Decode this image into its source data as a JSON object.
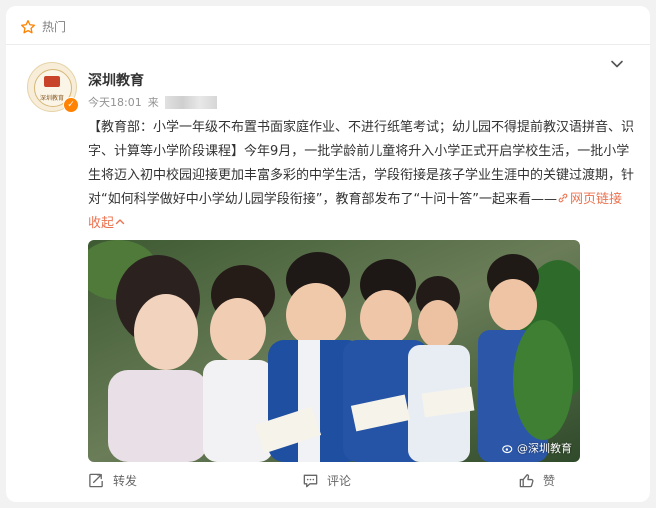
{
  "header": {
    "hot_label": "热门"
  },
  "post": {
    "author": "深圳教育",
    "time": "今天18:01",
    "source_prefix": "来",
    "avatar_text": "深圳教育",
    "text_main": "【教育部：小学一年级不布置书面家庭作业、不进行纸笔考试；幼儿园不得提前教汉语拼音、识字、计算等小学阶段课程】今年9月，一批学龄前儿童将升入小学正式开启学校生活，一批小学生将迈入初中校园迎接更加丰富多彩的中学生活，学段衔接是孩子学业生涯中的关键过渡期，针对“如何科学做好中小学幼儿园学段衔接”，教育部发布了“十问十答”一起来看——",
    "link_text": "网页链接",
    "collapse_text": "收起",
    "image_watermark": "@深圳教育"
  },
  "actions": {
    "repost": "转发",
    "comment": "评论",
    "like": "赞"
  },
  "colors": {
    "accent": "#eb7350",
    "verified": "#ff8200",
    "hot_star": "#ff8200"
  }
}
